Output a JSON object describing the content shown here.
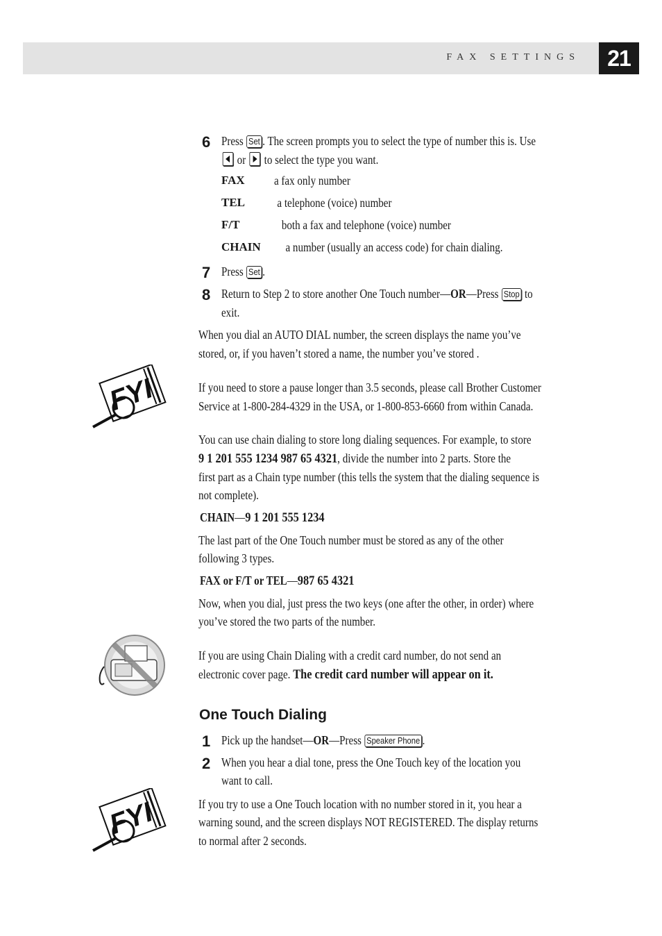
{
  "header": {
    "section_title": "FAX SETTINGS",
    "page_number": "21"
  },
  "steps_top": [
    {
      "num": "6",
      "pre": "Press ",
      "key": "Set",
      "post": ". The screen prompts you to select the type of number this is. Use",
      "line2_mid": " or ",
      "line2_post": " to select the type you want."
    },
    {
      "num": "7",
      "pre": "Press ",
      "key": "Set",
      "post": "."
    },
    {
      "num": "8",
      "pre": "Return to Step 2 to store another One Touch number—",
      "or": "OR",
      "mid": "—Press ",
      "key": "Stop",
      "post": "  to",
      "line2": "exit."
    }
  ],
  "types": [
    {
      "term": "FAX",
      "desc": "a fax only number"
    },
    {
      "term": "TEL",
      "desc": "a telephone (voice) number"
    },
    {
      "term": "F/T",
      "desc": "both a fax and telephone (voice) number"
    },
    {
      "term": "CHAIN",
      "desc": "a number (usually an access code) for chain dialing."
    }
  ],
  "para_autodial": [
    "When you dial an AUTO DIAL number, the screen displays the name you’ve",
    "stored, or, if you haven’t stored a name, the number you’ve stored ."
  ],
  "fyi1": {
    "icon": "fyi-magnifier-icon",
    "lines": [
      "If you need to store a pause longer than 3.5 seconds, please call Brother Customer",
      "Service at 1-800-284-4329 in the USA, or 1-800-853-6660 from within Canada."
    ]
  },
  "chain_para": {
    "line1": "You can use chain dialing to store long dialing sequences. For example, to store",
    "line2_bold": "9 1 201 555 1234  987 65 4321",
    "line2_rest": ", divide the number into 2 parts. Store the",
    "line3": "first part as a Chain type number (this tells the system that the dialing sequence is",
    "line4": "not complete)."
  },
  "chain_example": {
    "label": "CHAIN",
    "dash": "—",
    "number": "9 1 201 555 1234"
  },
  "last_part": [
    "The last part of the One Touch number must be stored as any of the other",
    "following 3 types."
  ],
  "types_example": {
    "label": "FAX or F/T or TEL",
    "dash": "—",
    "number": "987 65 4321"
  },
  "now_dial": [
    "Now, when you dial, just press the two keys (one after the other, in order) where",
    "you’ve stored the two parts of the number."
  ],
  "warning": {
    "icon": "no-fax-machine-icon",
    "line1": "If you are using Chain Dialing with a credit card number, do not send an",
    "line2_pre": "electronic cover page. ",
    "line2_bold": "The credit card number will appear on it."
  },
  "section": {
    "title": "One Touch Dialing",
    "steps": [
      {
        "num": "1",
        "pre": "Pick up the handset—",
        "or": "OR",
        "mid": "—Press ",
        "key": "Speaker Phone",
        "post": "."
      },
      {
        "num": "2",
        "line1": "When you hear a dial tone, press the One Touch key of the location you",
        "line2": "want to call."
      }
    ]
  },
  "fyi2": {
    "icon": "fyi-magnifier-icon",
    "lines": [
      "If you try to use a One Touch location with no number stored in it, you hear a",
      "warning sound, and the screen displays NOT REGISTERED.  The display returns",
      "to normal after 2 seconds."
    ]
  }
}
